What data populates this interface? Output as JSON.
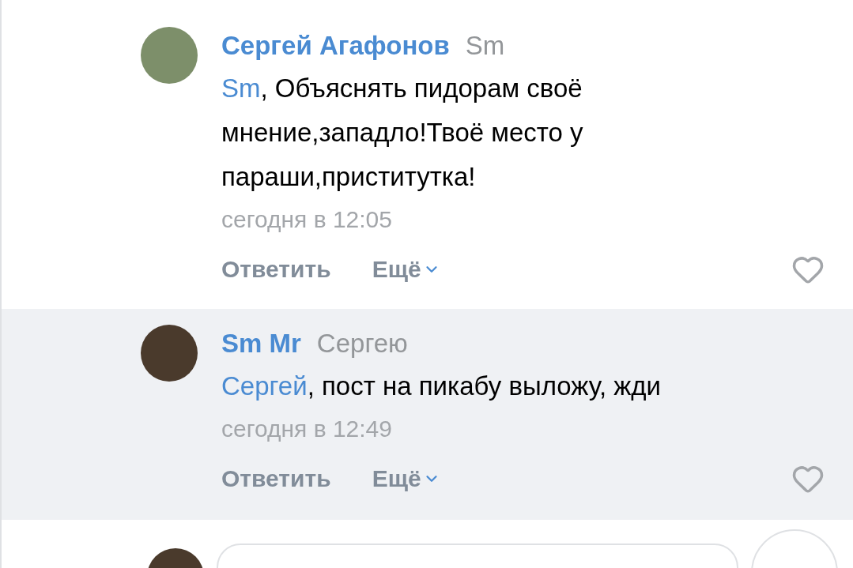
{
  "comments": [
    {
      "author": "Сергей Агафонов",
      "reply_to": "Sm",
      "mention": "Sm",
      "text": ", Объяснять пидорам своё мнение,западло!Твоё место у параши,приститутка!",
      "time": "сегодня в 12:05",
      "reply_label": "Ответить",
      "more_label": "Ещё",
      "highlighted": false
    },
    {
      "author": "Sm Mr",
      "reply_to": "Сергею",
      "mention": "Сергей",
      "text": ", пост на пикабу выложу, жди",
      "time": "сегодня в 12:49",
      "reply_label": "Ответить",
      "more_label": "Ещё",
      "highlighted": true
    }
  ]
}
